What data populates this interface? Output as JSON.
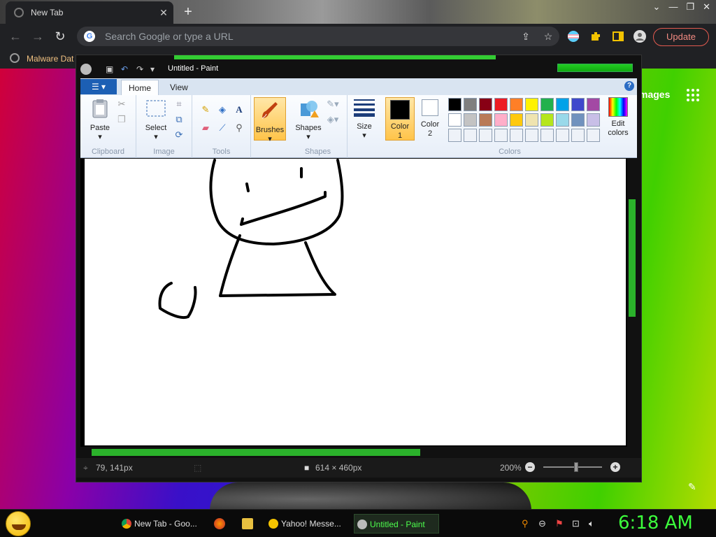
{
  "browser": {
    "tab_title": "New Tab",
    "omnibox_placeholder": "Search Google or type a URL",
    "update_label": "Update",
    "bookmark_label": "Malware Dat",
    "page_images_link": "mages"
  },
  "paint": {
    "window_title": "Untitled - Paint",
    "tabs": [
      "Home",
      "View"
    ],
    "groups": {
      "clipboard": {
        "label": "Clipboard",
        "paste": "Paste"
      },
      "image": {
        "label": "Image",
        "select": "Select"
      },
      "tools": {
        "label": "Tools"
      },
      "brushes": {
        "label": "Brushes"
      },
      "shapes": {
        "label": "Shapes",
        "shapes_btn": "Shapes"
      },
      "size": {
        "label": "Size"
      },
      "colors": {
        "label": "Colors",
        "color1": "Color\n1",
        "color1_a": "Color",
        "color1_b": "1",
        "color2_a": "Color",
        "color2_b": "2",
        "edit_a": "Edit",
        "edit_b": "colors"
      }
    },
    "palette": [
      "#000000",
      "#7f7f7f",
      "#880015",
      "#ed1c24",
      "#ff7f27",
      "#fff200",
      "#22b14c",
      "#00a2e8",
      "#3f48cc",
      "#a349a4",
      "#ffffff",
      "#c3c3c3",
      "#b97a57",
      "#ffaec9",
      "#ffc90e",
      "#efe4b0",
      "#b5e61d",
      "#99d9ea",
      "#7092be",
      "#c8bfe7"
    ],
    "empty_swatch_count": 10,
    "status": {
      "cursor_pos": "79, 141px",
      "canvas_size": "614 × 460px",
      "zoom": "200%"
    }
  },
  "taskbar": {
    "tasks": [
      {
        "label": "New Tab - Goo...",
        "active": false
      },
      {
        "label": "Yahoo! Messe...",
        "active": false
      },
      {
        "label": "Untitled - Paint",
        "active": true
      }
    ],
    "clock": "6:18 AM"
  }
}
